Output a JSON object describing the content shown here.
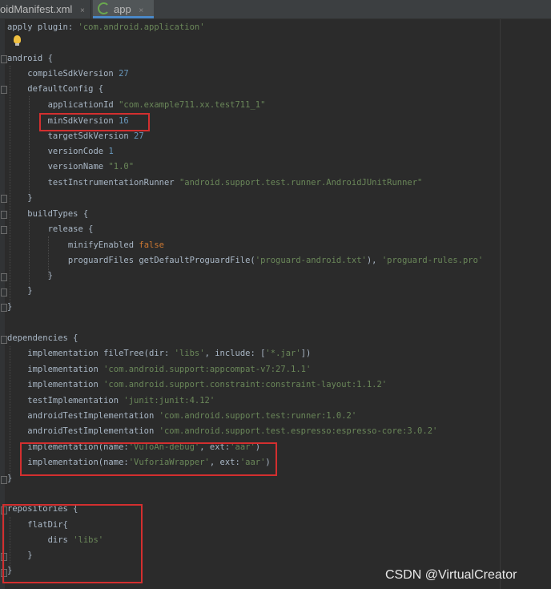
{
  "tabs": [
    {
      "label": "oidManifest.xml",
      "close": "×"
    },
    {
      "label": "app",
      "close": "×"
    }
  ],
  "code": [
    "apply plugin: 'com.android.application'",
    "",
    "android {",
    "    compileSdkVersion 27",
    "    defaultConfig {",
    "        applicationId \"com.example711.xx.test711_1\"",
    "        minSdkVersion 16",
    "        targetSdkVersion 27",
    "        versionCode 1",
    "        versionName \"1.0\"",
    "        testInstrumentationRunner \"android.support.test.runner.AndroidJUnitRunner\"",
    "    }",
    "    buildTypes {",
    "        release {",
    "            minifyEnabled false",
    "            proguardFiles getDefaultProguardFile('proguard-android.txt'), 'proguard-rules.pro'",
    "        }",
    "    }",
    "}",
    "",
    "dependencies {",
    "    implementation fileTree(dir: 'libs', include: ['*.jar'])",
    "    implementation 'com.android.support:appcompat-v7:27.1.1'",
    "    implementation 'com.android.support.constraint:constraint-layout:1.1.2'",
    "    testImplementation 'junit:junit:4.12'",
    "    androidTestImplementation 'com.android.support.test:runner:1.0.2'",
    "    androidTestImplementation 'com.android.support.test.espresso:espresso-core:3.0.2'",
    "    implementation(name:'VuToAn-debug', ext:'aar')",
    "    implementation(name:'VuforiaWrapper', ext:'aar')",
    "}",
    "",
    "repositories {",
    "    flatDir{",
    "        dirs 'libs'",
    "    }",
    "}"
  ],
  "watermark": "CSDN @VirtualCreator",
  "colors": {
    "highlight_box": "#d32f2f",
    "background": "#2b2b2b",
    "string": "#6a8759",
    "number": "#6897bb",
    "keyword": "#cc7832"
  },
  "icons": [
    "app-module-icon",
    "intention-bulb-icon",
    "fold-marker-icon"
  ]
}
